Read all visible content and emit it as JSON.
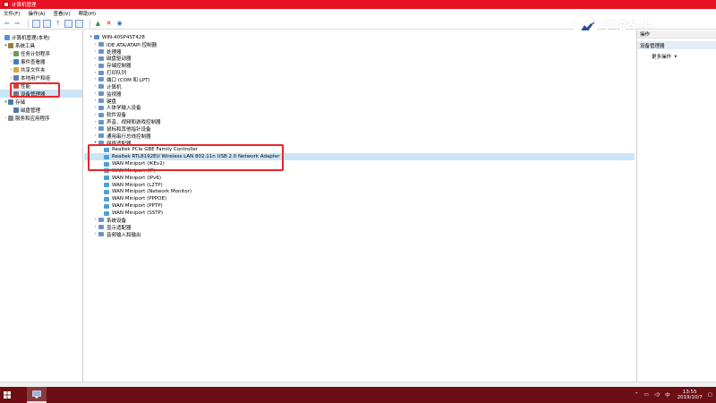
{
  "window": {
    "title": "计算机管理"
  },
  "menu": [
    "文件(F)",
    "操作(A)",
    "查看(V)",
    "帮助(H)"
  ],
  "left_tree": {
    "root": "计算机管理(本地)",
    "system_tools": "系统工具",
    "task_scheduler": "任务计划程序",
    "event_viewer": "事件查看器",
    "shared_folders": "共享文件夹",
    "local_users": "本地用户和组",
    "performance": "性能",
    "device_manager": "设备管理器",
    "storage": "存储",
    "disk_management": "磁盘管理",
    "services": "服务和应用程序"
  },
  "device_tree": {
    "computer_name": "WIN-40SP4ST428",
    "categories": [
      "IDE ATA/ATAPI 控制器",
      "处理器",
      "磁盘驱动器",
      "存储控制器",
      "打印队列",
      "端口 (COM 和 LPT)",
      "计算机",
      "监视器",
      "键盘",
      "人体学输入设备",
      "软件设备",
      "声音、视频和游戏控制器",
      "鼠标和其他指针设备",
      "通用串行总线控制器"
    ],
    "network_adapters_label": "网络适配器",
    "network_adapters": [
      "Realtek PCIe GBE Family Controller",
      "Realtek RTL8192EU Wireless LAN 802.11n USB 2.0 Network Adapter",
      "WAN Miniport (IKEv2)",
      "WAN Miniport (IP)",
      "WAN Miniport (IPv6)",
      "WAN Miniport (L2TP)",
      "WAN Miniport (Network Monitor)",
      "WAN Miniport (PPPOE)",
      "WAN Miniport (PPTP)",
      "WAN Miniport (SSTP)"
    ],
    "trailing_categories": [
      "系统设备",
      "显示适配器",
      "音频输入和输出"
    ]
  },
  "actions_pane": {
    "header": "操作",
    "section": "设备管理器",
    "more": "更多操作"
  },
  "watermark": {
    "text": "云骑士"
  },
  "taskbar": {
    "input_method": "中",
    "time": "13:55",
    "date": "2019/10/7"
  },
  "colors": {
    "title_bar": "#e81123",
    "taskbar": "#6b0f14",
    "annotation": "#e8262c",
    "selection": "#cce4f7"
  }
}
